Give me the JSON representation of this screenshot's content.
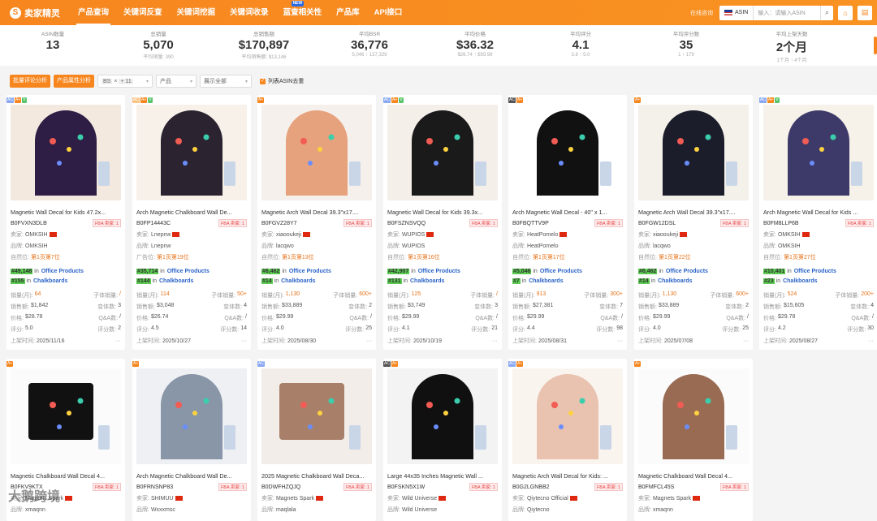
{
  "app": {
    "logo_text": "卖家精灵",
    "online": "在线咨询"
  },
  "nav": [
    {
      "label": "产品查询",
      "active": true
    },
    {
      "label": "关键词反查"
    },
    {
      "label": "关键词挖掘"
    },
    {
      "label": "关键词收录"
    },
    {
      "label": "蓝查相关性",
      "badge": "NEW"
    },
    {
      "label": "产品库"
    },
    {
      "label": "API接口"
    }
  ],
  "search": {
    "market": "ASIN",
    "placeholder": "输入：请输入ASIN",
    "flag": "us-flag-icon"
  },
  "stats": [
    {
      "label": "ASIN数量",
      "value": "13",
      "sub": ""
    },
    {
      "label": "总销量",
      "value": "5,070",
      "sub": "平均销量: 390"
    },
    {
      "label": "总销售额",
      "value": "$170,897",
      "sub": "平均销售额: $13,146"
    },
    {
      "label": "平均BSR",
      "value": "36,776",
      "sub": "5,046 ↑ 137,329"
    },
    {
      "label": "平均价格",
      "value": "$36.32",
      "sub": "$26.74 ↑ $59.99"
    },
    {
      "label": "平均评分",
      "value": "4.1",
      "sub": "3.8 ↑ 5.0"
    },
    {
      "label": "平均评分数",
      "value": "35",
      "sub": "1 ↑ 179"
    },
    {
      "label": "平均上架天数",
      "value": "2个月",
      "sub": "1个月 ↑ 4个月"
    }
  ],
  "filters": {
    "btn1": "批量评论分析",
    "btn2": "产品属性分析",
    "bs_tag": "BS",
    "bs_count": "+ 11",
    "select1": "产品",
    "select2": "展示全部",
    "checkbox": "列表ASIN去重"
  },
  "labels": {
    "seller": "卖家:",
    "brand": "品牌:",
    "adv": "广告位:",
    "selfpos": "自然位:",
    "in": "in",
    "sales_vol": "销量(月):",
    "sales_amt": "销售额:",
    "price": "价格:",
    "rating": "评分:",
    "listed": "上架时间:",
    "child_sales": "子体销量:",
    "variants": "变体数:",
    "qa": "Q&A数:",
    "reviews": "评分数:",
    "fba": "FBA",
    "sellers": "卖家: 1"
  },
  "products": [
    {
      "badges": [
        "b",
        "a",
        "v"
      ],
      "title": "Magnetic Wall Decal for Kids 47.2x...",
      "asin": "B0FVXN3DLB",
      "fba": true,
      "seller": "OMKSIH",
      "brand": "OMKSIH",
      "pos_label": "自然位:",
      "pos": "第1页第7位",
      "bsr": "#49,148",
      "cat1": "Office Products",
      "bsr2": "#155",
      "cat2": "Chalkboards",
      "sales": "64",
      "child": "/",
      "amt": "$1,842",
      "var": "3",
      "price": "$28.78",
      "qa": "/",
      "rating": "5.0",
      "reviews": "2",
      "date": "2025/11/16"
    },
    {
      "badges": [
        "av",
        "a",
        "v"
      ],
      "title": "Arch Magnetic Chalkboard Wall De...",
      "asin": "B0FP14443C",
      "fba": true,
      "seller": "Lnepnw",
      "brand": "Lnepnw",
      "pos_label": "广告位:",
      "pos": "第1页第19位",
      "bsr": "#35,714",
      "cat1": "Office Products",
      "bsr2": "#144",
      "cat2": "Chalkboards",
      "sales": "114",
      "child": "50+",
      "amt": "$3,048",
      "var": "4",
      "price": "$26.74",
      "qa": "/",
      "rating": "4.5",
      "reviews": "14",
      "date": "2025/10/27"
    },
    {
      "badges": [
        "a"
      ],
      "title": "Magnetic Arch Wall Decal 39.3\"x17....",
      "asin": "B0FGVZ28Y7",
      "fba": true,
      "seller": "xiaooukeji",
      "brand": "lacqwo",
      "pos_label": "自然位:",
      "pos": "第1页第13位",
      "bsr": "#6,462",
      "cat1": "Office Products",
      "bsr2": "#14",
      "cat2": "Chalkboards",
      "sales": "1,130",
      "child": "600+",
      "amt": "$33,889",
      "var": "2",
      "price": "$29.99",
      "qa": "/",
      "rating": "4.0",
      "reviews": "25",
      "date": "2025/08/30"
    },
    {
      "badges": [
        "b",
        "a",
        "v"
      ],
      "title": "Magnetic Wall Decal for Kids 39.3x...",
      "asin": "B0FSZNSVQQ",
      "fba": true,
      "seller": "WUPIOS",
      "brand": "WUPIOS",
      "pos_label": "自然位:",
      "pos": "第1页第16位",
      "bsr": "#42,907",
      "cat1": "Office Products",
      "bsr2": "#131",
      "cat2": "Chalkboards",
      "sales": "125",
      "child": "/",
      "amt": "$3,749",
      "var": "3",
      "price": "$29.99",
      "qa": "/",
      "rating": "4.1",
      "reviews": "21",
      "date": "2025/10/19"
    },
    {
      "badges": [
        "ac",
        "a"
      ],
      "title": "Arch Magnetic Wall Decal - 40\" x 1...",
      "asin": "B0FBQTTV9P",
      "fba": true,
      "seller": "HeatPomelo",
      "brand": "HeatPomelo",
      "pos_label": "自然位:",
      "pos": "第1页第17位",
      "bsr": "#5,046",
      "cat1": "Office Products",
      "bsr2": "#7",
      "cat2": "Chalkboards",
      "sales": "913",
      "child": "300+",
      "amt": "$27,381",
      "var": "7",
      "price": "$29.99",
      "qa": "/",
      "rating": "4.4",
      "reviews": "98",
      "date": "2025/08/31"
    },
    {
      "badges": [
        "a"
      ],
      "title": "Magnetic Arch Wall Decal 39.3\"x17....",
      "asin": "B0FGW12DSL",
      "fba": true,
      "seller": "xiaooukeji",
      "brand": "lacqwo",
      "pos_label": "自然位:",
      "pos": "第1页第22位",
      "bsr": "#6,462",
      "cat1": "Office Products",
      "bsr2": "#14",
      "cat2": "Chalkboards",
      "sales": "1,130",
      "child": "600+",
      "amt": "$33,889",
      "var": "2",
      "price": "$29.99",
      "qa": "/",
      "rating": "4.0",
      "reviews": "25",
      "date": "2025/07/08"
    },
    {
      "badges": [
        "b",
        "a",
        "v"
      ],
      "title": "Arch Magnetic Wall Decal for Kids ...",
      "asin": "B0FM8LLP6B",
      "fba": true,
      "seller": "OMKSIH",
      "brand": "OMKSIH",
      "pos_label": "自然位:",
      "pos": "第1页第27位",
      "bsr": "#10,401",
      "cat1": "Office Products",
      "bsr2": "#23",
      "cat2": "Chalkboards",
      "sales": "524",
      "child": "200+",
      "amt": "$15,605",
      "var": "4",
      "price": "$29.78",
      "qa": "/",
      "rating": "4.2",
      "reviews": "30",
      "date": "2025/08/27"
    },
    {
      "badges": [
        "a"
      ],
      "title": "Magnetic Chalkboard Wall Decal 4...",
      "asin": "B0FKV9KTX",
      "fba": true,
      "seller": "Magnets Spark",
      "brand": "xmaqnn",
      "short": true
    },
    {
      "badges": [
        "a"
      ],
      "title": "Arch Magnetic Chalkboard Wall De...",
      "asin": "B0FRNSNP83",
      "fba": true,
      "seller": "SHIMUU",
      "brand": "Wxxxmsc",
      "short": true
    },
    {
      "badges": [
        "b"
      ],
      "title": "2025 Magnetic Chalkboard Wall Deca...",
      "asin": "B0DWFHZQJQ",
      "fba": true,
      "seller": "Magnets Spark",
      "brand": "maqlala",
      "short": true
    },
    {
      "badges": [
        "ac",
        "a"
      ],
      "title": "Large 44x35 Inches Magnetic Wall ...",
      "asin": "B0FSKN5X1W",
      "fba": true,
      "seller": "Wild Universe",
      "brand": "Wild Universe",
      "short": true
    },
    {
      "badges": [
        "b",
        "a"
      ],
      "title": "Magnetic Arch Wall Decal for Kids: ...",
      "asin": "B0G2LGNBB2",
      "fba": true,
      "seller": "Qiytecno Official",
      "brand": "Qiytecno",
      "short": true
    },
    {
      "badges": [
        "a"
      ],
      "title": "Magnetic Chalkboard Wall Decal 4...",
      "asin": "B0FMFCL45S",
      "fba": true,
      "seller": "Magnets Spark",
      "brand": "xmaqnn",
      "short": true
    }
  ],
  "watermark": "大鹅跨境"
}
